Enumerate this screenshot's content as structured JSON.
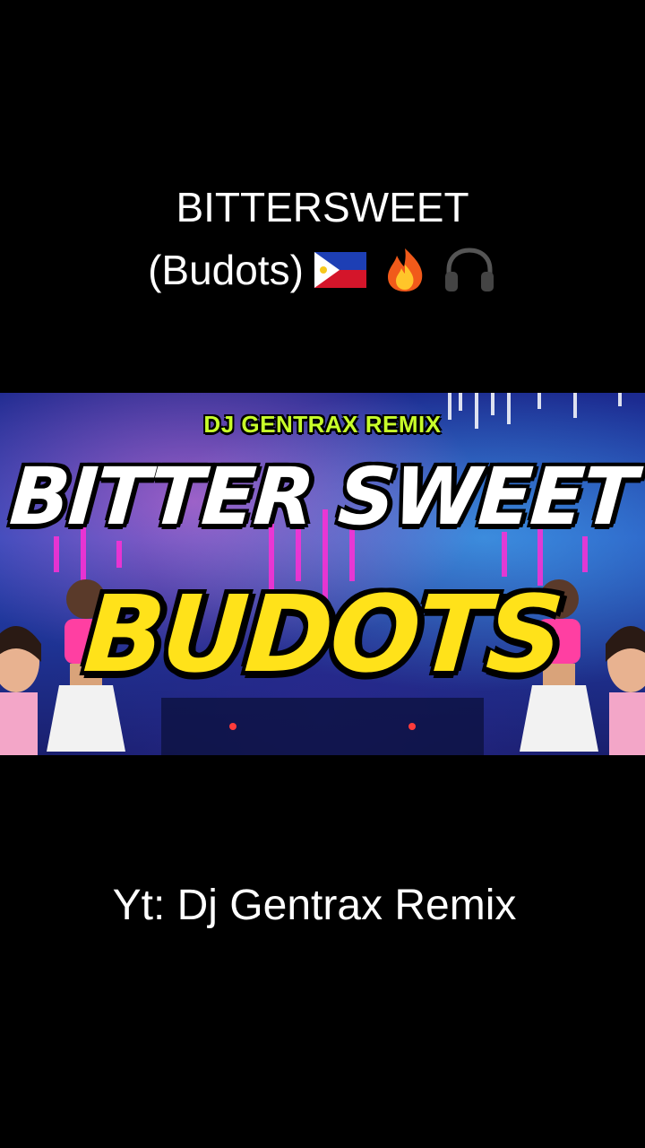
{
  "caption": {
    "title": "BITTERSWEET",
    "subtitle": "(Budots)",
    "emojis": [
      "philippines-flag-icon",
      "fire-icon",
      "headphones-icon"
    ]
  },
  "thumbnail": {
    "label": "DJ GENTRAX REMIX",
    "title_line1": "BITTER SWEET",
    "title_line2": "BUDOTS"
  },
  "credit": "Yt: Dj Gentrax Remix"
}
